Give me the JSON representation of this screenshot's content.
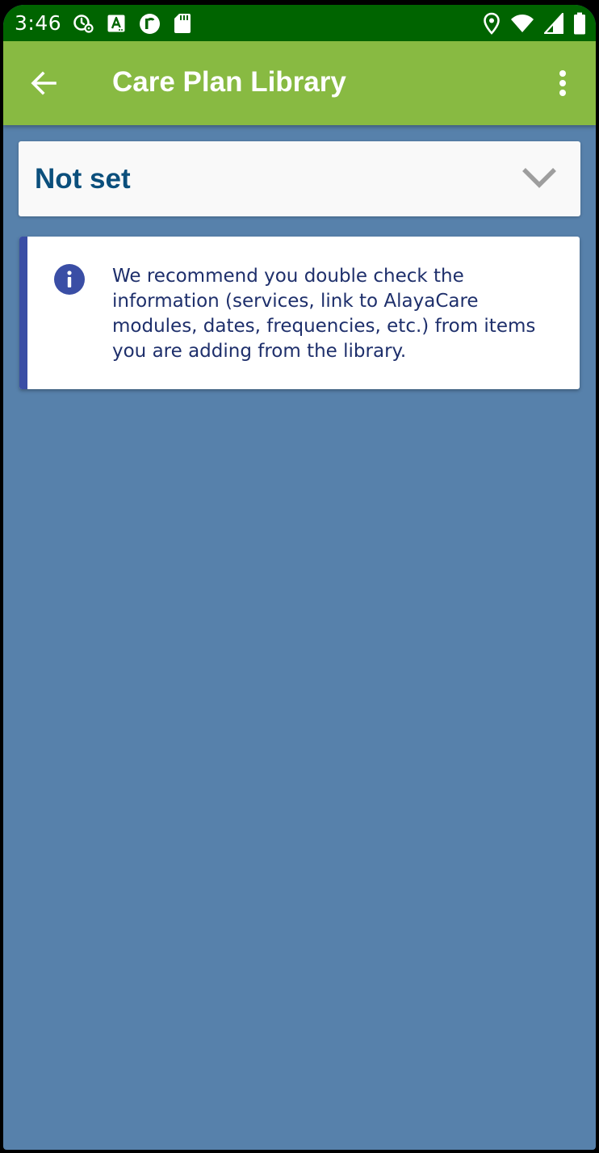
{
  "status_bar": {
    "time": "3:46",
    "left_icons": [
      "data-saver-icon",
      "accessibility-a-icon",
      "app-r-icon",
      "sd-card-icon"
    ],
    "right_icons": [
      "location-pin-icon",
      "wifi-icon",
      "cell-signal-icon",
      "battery-icon"
    ]
  },
  "app_bar": {
    "title": "Care Plan Library",
    "back_icon": "arrow-back-icon",
    "menu_icon": "more-vert-icon"
  },
  "filter": {
    "selected_value": "Not set",
    "icon": "chevron-down-icon"
  },
  "info_notice": {
    "icon": "info-icon",
    "text": "We recommend you double check the information (services, link to AlayaCare modules, dates, frequencies, etc.) from items you are adding from the library."
  },
  "colors": {
    "status_bar": "#006400",
    "app_bar": "#88ba42",
    "background": "#5781ab",
    "accent": "#3a4ea5",
    "select_text": "#0b4f7c",
    "notice_text": "#1e2f6b"
  }
}
